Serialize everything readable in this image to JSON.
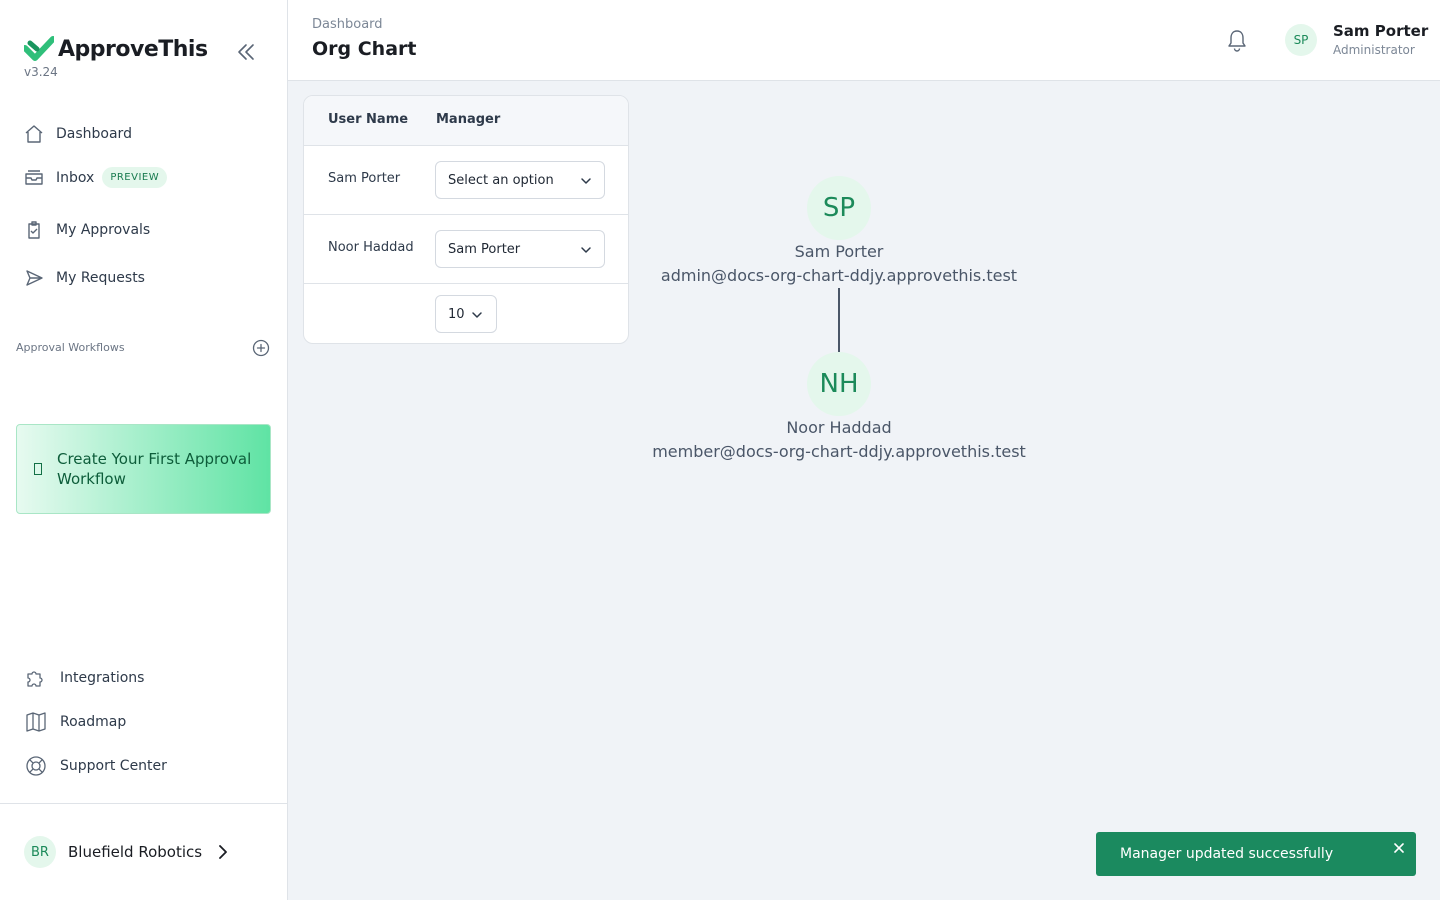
{
  "app": {
    "name": "ApproveThis",
    "version": "v3.24"
  },
  "sidebar": {
    "nav": [
      {
        "label": "Dashboard",
        "icon": "home-icon"
      },
      {
        "label": "Inbox",
        "icon": "inbox-icon",
        "badge": "PREVIEW"
      },
      {
        "label": "My Approvals",
        "icon": "clipboard-icon"
      },
      {
        "label": "My Requests",
        "icon": "send-icon"
      }
    ],
    "section_label": "Approval Workflows",
    "create_card_label": "Create Your First Approval Workflow",
    "bottom_nav": [
      {
        "label": "Integrations",
        "icon": "puzzle-icon"
      },
      {
        "label": "Roadmap",
        "icon": "map-icon"
      },
      {
        "label": "Support Center",
        "icon": "lifebuoy-icon"
      }
    ],
    "org": {
      "initials": "BR",
      "name": "Bluefield Robotics"
    }
  },
  "header": {
    "breadcrumb": "Dashboard",
    "title": "Org Chart",
    "user": {
      "initials": "SP",
      "name": "Sam Porter",
      "role": "Administrator"
    }
  },
  "table": {
    "columns": [
      "User Name",
      "Manager"
    ],
    "rows": [
      {
        "name": "Sam Porter",
        "manager": "Select an option"
      },
      {
        "name": "Noor Haddad",
        "manager": "Sam Porter"
      }
    ],
    "page_size": "10"
  },
  "org_chart": {
    "nodes": [
      {
        "initials": "SP",
        "name": "Sam Porter",
        "email": "admin@docs-org-chart-ddjy.approvethis.test"
      },
      {
        "initials": "NH",
        "name": "Noor Haddad",
        "email": "member@docs-org-chart-ddjy.approvethis.test"
      }
    ]
  },
  "toast": {
    "message": "Manager updated successfully"
  },
  "colors": {
    "accent": "#1b8a5f",
    "avatar_bg": "#e4f7ec",
    "page_bg": "#f0f3f7"
  }
}
